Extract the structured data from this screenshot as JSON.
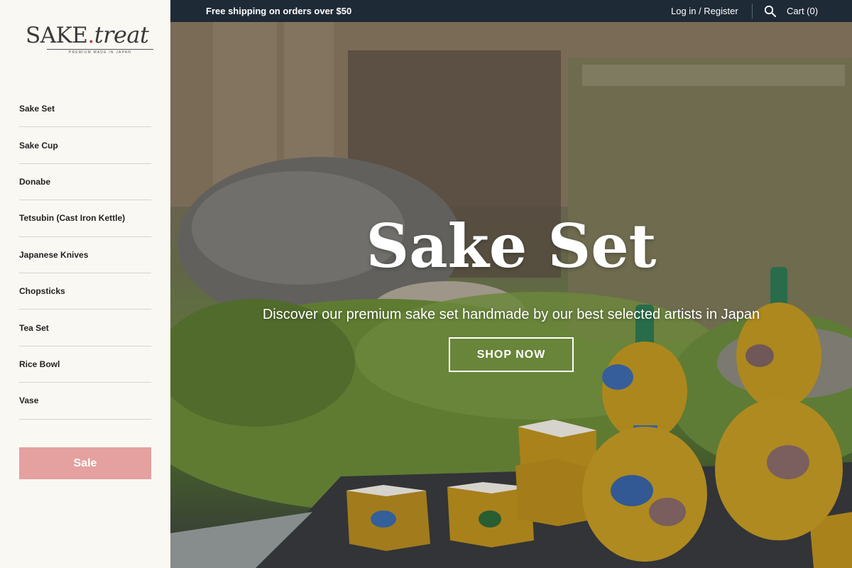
{
  "logo": {
    "main": "SAKE",
    "dot": ".",
    "script": "treat",
    "tagline": "PREMIUM MADE IN JAPAN"
  },
  "sidebar": {
    "items": [
      {
        "label": "Sake Set"
      },
      {
        "label": "Sake Cup"
      },
      {
        "label": "Donabe"
      },
      {
        "label": "Tetsubin (Cast Iron Kettle)"
      },
      {
        "label": "Japanese Knives"
      },
      {
        "label": "Chopsticks"
      },
      {
        "label": "Tea Set"
      },
      {
        "label": "Rice Bowl"
      },
      {
        "label": "Vase"
      }
    ],
    "sale_label": "Sale"
  },
  "topbar": {
    "shipping": "Free shipping on orders over $50",
    "login": "Log in / Register",
    "search_icon": "search-icon",
    "cart": "Cart (0)"
  },
  "hero": {
    "title": "Sake Set",
    "subtitle": "Discover our premium sake set handmade by our best selected artists in Japan",
    "button": "SHOP NOW"
  },
  "colors": {
    "topbar": "#1f2a37",
    "sidebar_bg": "#faf8f3",
    "sale_button": "#e4a19f",
    "logo_dot": "#c8344a"
  }
}
